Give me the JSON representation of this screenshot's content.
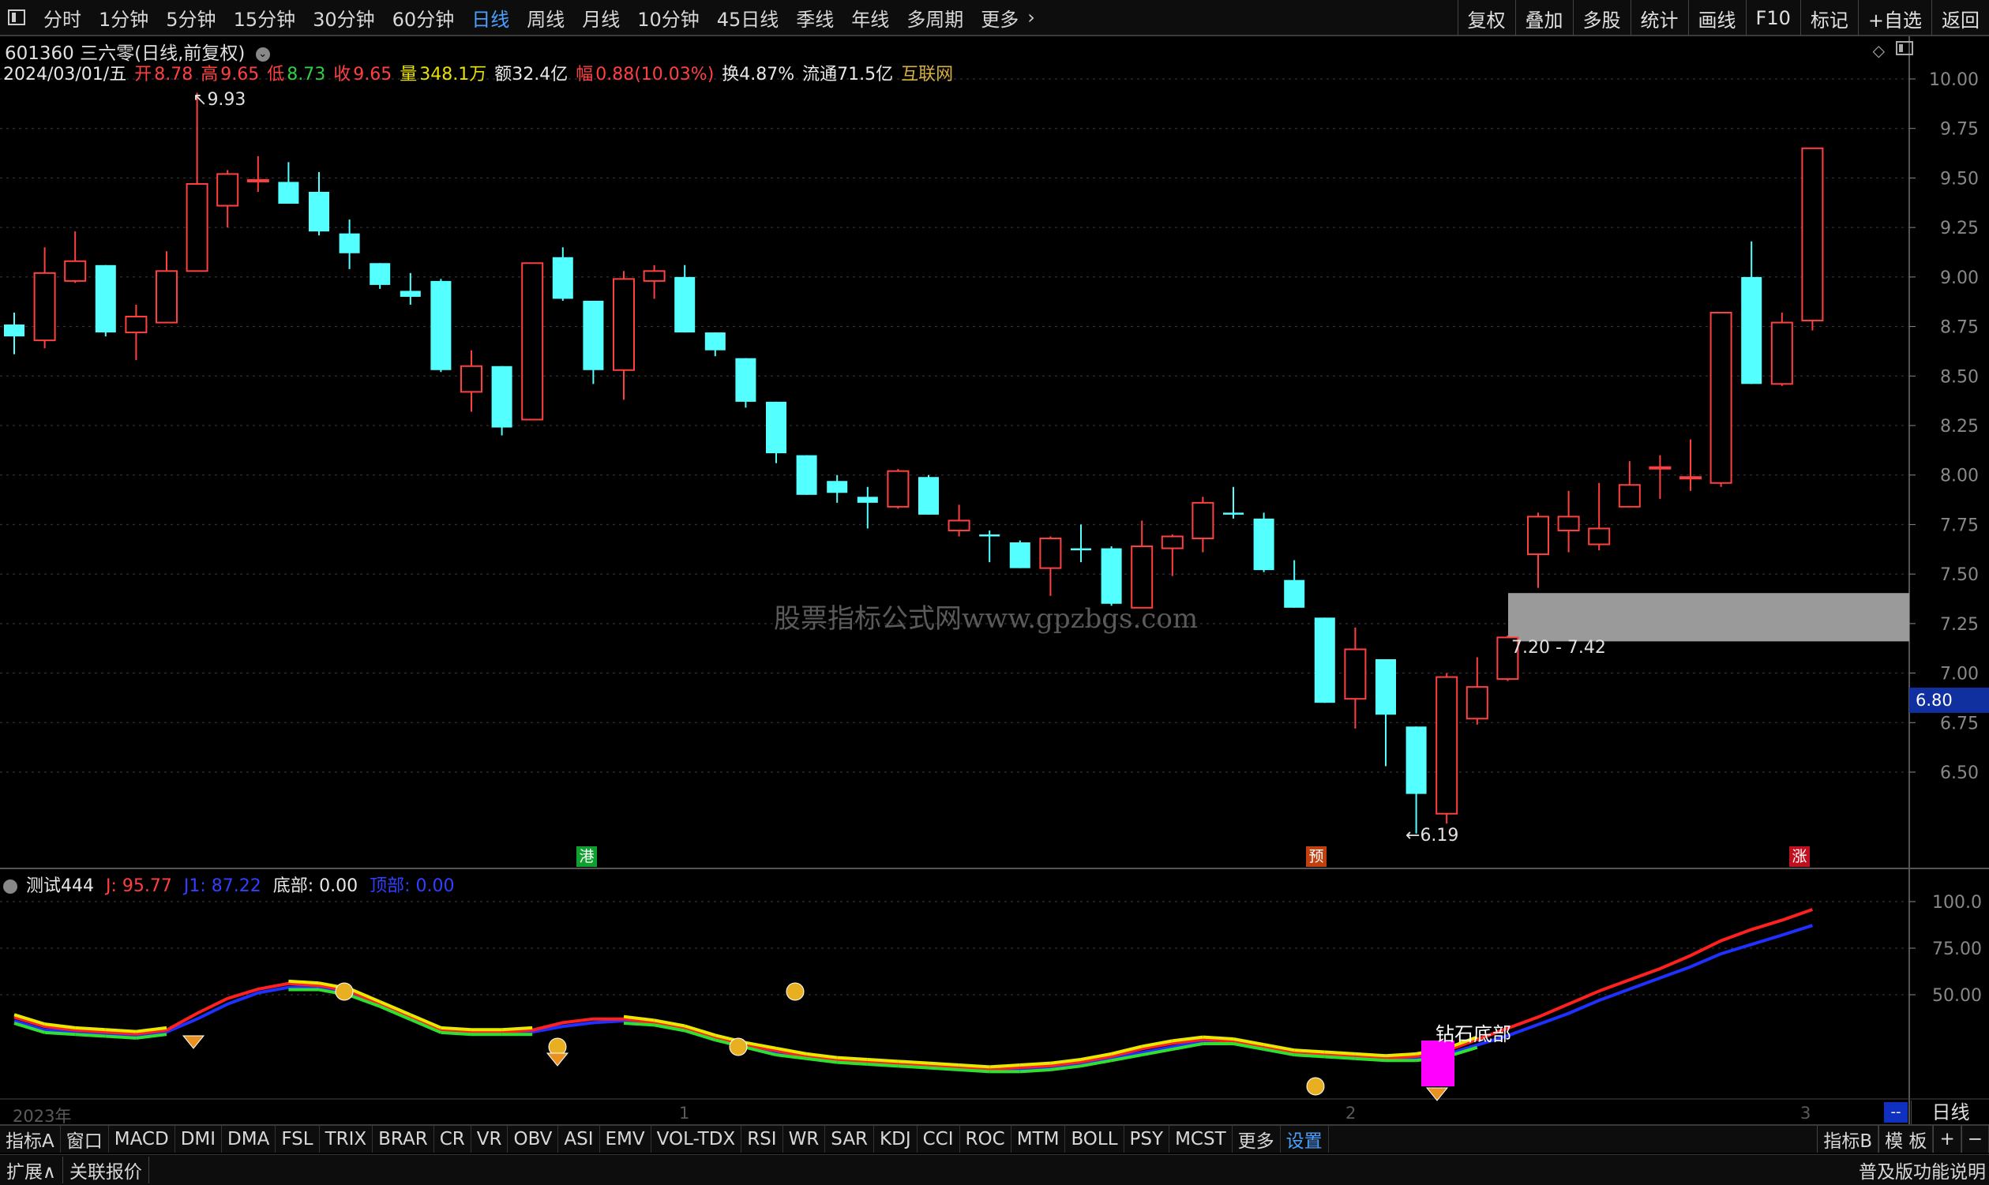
{
  "topbar": {
    "periods": [
      "分时",
      "1分钟",
      "5分钟",
      "15分钟",
      "30分钟",
      "60分钟",
      "日线",
      "周线",
      "月线",
      "10分钟",
      "45日线",
      "季线",
      "年线",
      "多周期",
      "更多"
    ],
    "active_period": "日线",
    "right_buttons": [
      "复权",
      "叠加",
      "多股",
      "统计",
      "画线",
      "F10",
      "标记",
      "+自选",
      "返回"
    ]
  },
  "stock": {
    "title": "601360 三六零(日线,前复权)",
    "date": "2024/03/01/五",
    "open_label": "开",
    "open": "8.78",
    "high_label": "高",
    "high": "9.65",
    "low_label": "低",
    "low": "8.73",
    "close_label": "收",
    "close": "9.65",
    "volume_label": "量",
    "volume": "348.1万",
    "amount": "额32.4亿",
    "change_label": "幅",
    "change": "0.88(10.03%)",
    "turnover": "换4.87%",
    "float_cap": "流通71.5亿",
    "concept": "互联网"
  },
  "chart_data": [
    {
      "type": "candlestick",
      "title": "601360 三六零(日线,前复权)",
      "ylim": [
        6.0,
        10.1
      ],
      "y_ticks": [
        "10.00",
        "9.75",
        "9.50",
        "9.25",
        "9.00",
        "8.75",
        "8.50",
        "8.25",
        "8.00",
        "7.75",
        "7.50",
        "7.25",
        "7.00",
        "6.75",
        "6.50"
      ],
      "x_labels": [
        "2023年",
        "1",
        "2",
        "3"
      ],
      "candles": [
        {
          "o": 8.76,
          "c": 8.7,
          "h": 8.82,
          "l": 8.61
        },
        {
          "o": 8.68,
          "c": 9.02,
          "h": 9.15,
          "l": 8.64
        },
        {
          "o": 8.98,
          "c": 9.08,
          "h": 9.23,
          "l": 8.97
        },
        {
          "o": 9.06,
          "c": 8.72,
          "h": 9.06,
          "l": 8.7
        },
        {
          "o": 8.72,
          "c": 8.8,
          "h": 8.86,
          "l": 8.58
        },
        {
          "o": 8.77,
          "c": 9.03,
          "h": 9.13,
          "l": 8.77
        },
        {
          "o": 9.03,
          "c": 9.47,
          "h": 9.93,
          "l": 9.03
        },
        {
          "o": 9.36,
          "c": 9.52,
          "h": 9.54,
          "l": 9.25
        },
        {
          "o": 9.49,
          "c": 9.49,
          "h": 9.61,
          "l": 9.43
        },
        {
          "o": 9.48,
          "c": 9.37,
          "h": 9.58,
          "l": 9.37
        },
        {
          "o": 9.43,
          "c": 9.23,
          "h": 9.53,
          "l": 9.21
        },
        {
          "o": 9.22,
          "c": 9.12,
          "h": 9.29,
          "l": 9.04
        },
        {
          "o": 9.07,
          "c": 8.96,
          "h": 9.07,
          "l": 8.94
        },
        {
          "o": 8.93,
          "c": 8.9,
          "h": 9.02,
          "l": 8.86
        },
        {
          "o": 8.98,
          "c": 8.53,
          "h": 8.99,
          "l": 8.52
        },
        {
          "o": 8.42,
          "c": 8.55,
          "h": 8.63,
          "l": 8.32
        },
        {
          "o": 8.55,
          "c": 8.24,
          "h": 8.55,
          "l": 8.2
        },
        {
          "o": 8.28,
          "c": 9.07,
          "h": 9.07,
          "l": 8.28
        },
        {
          "o": 9.1,
          "c": 8.89,
          "h": 9.15,
          "l": 8.88
        },
        {
          "o": 8.88,
          "c": 8.53,
          "h": 8.88,
          "l": 8.46
        },
        {
          "o": 8.53,
          "c": 8.99,
          "h": 9.03,
          "l": 8.38
        },
        {
          "o": 8.98,
          "c": 9.03,
          "h": 9.06,
          "l": 8.89
        },
        {
          "o": 9.0,
          "c": 8.72,
          "h": 9.06,
          "l": 8.72
        },
        {
          "o": 8.72,
          "c": 8.63,
          "h": 8.72,
          "l": 8.6
        },
        {
          "o": 8.59,
          "c": 8.37,
          "h": 8.59,
          "l": 8.34
        },
        {
          "o": 8.37,
          "c": 8.11,
          "h": 8.37,
          "l": 8.06
        },
        {
          "o": 8.1,
          "c": 7.9,
          "h": 8.1,
          "l": 7.9
        },
        {
          "o": 7.97,
          "c": 7.91,
          "h": 8.0,
          "l": 7.86
        },
        {
          "o": 7.89,
          "c": 7.86,
          "h": 7.94,
          "l": 7.73
        },
        {
          "o": 7.84,
          "c": 8.02,
          "h": 8.03,
          "l": 7.83
        },
        {
          "o": 7.99,
          "c": 7.8,
          "h": 8.0,
          "l": 7.8
        },
        {
          "o": 7.72,
          "c": 7.77,
          "h": 7.85,
          "l": 7.69
        },
        {
          "o": 7.7,
          "c": 7.69,
          "h": 7.72,
          "l": 7.56
        },
        {
          "o": 7.66,
          "c": 7.53,
          "h": 7.67,
          "l": 7.53
        },
        {
          "o": 7.53,
          "c": 7.68,
          "h": 7.69,
          "l": 7.39
        },
        {
          "o": 7.63,
          "c": 7.62,
          "h": 7.75,
          "l": 7.56
        },
        {
          "o": 7.63,
          "c": 7.35,
          "h": 7.64,
          "l": 7.34
        },
        {
          "o": 7.33,
          "c": 7.64,
          "h": 7.77,
          "l": 7.33
        },
        {
          "o": 7.63,
          "c": 7.69,
          "h": 7.7,
          "l": 7.49
        },
        {
          "o": 7.68,
          "c": 7.86,
          "h": 7.89,
          "l": 7.61
        },
        {
          "o": 7.81,
          "c": 7.8,
          "h": 7.94,
          "l": 7.78
        },
        {
          "o": 7.78,
          "c": 7.52,
          "h": 7.81,
          "l": 7.51
        },
        {
          "o": 7.47,
          "c": 7.33,
          "h": 7.57,
          "l": 7.33
        },
        {
          "o": 7.28,
          "c": 6.85,
          "h": 7.28,
          "l": 6.85
        },
        {
          "o": 6.87,
          "c": 7.12,
          "h": 7.23,
          "l": 6.72
        },
        {
          "o": 7.07,
          "c": 6.79,
          "h": 7.07,
          "l": 6.53
        },
        {
          "o": 6.73,
          "c": 6.39,
          "h": 6.73,
          "l": 6.19
        },
        {
          "o": 6.29,
          "c": 6.98,
          "h": 7.0,
          "l": 6.24
        },
        {
          "o": 6.77,
          "c": 6.93,
          "h": 7.08,
          "l": 6.74
        },
        {
          "o": 6.97,
          "c": 7.18,
          "h": 7.19,
          "l": 6.96
        },
        {
          "o": 7.6,
          "c": 7.79,
          "h": 7.81,
          "l": 7.43
        },
        {
          "o": 7.72,
          "c": 7.79,
          "h": 7.92,
          "l": 7.61
        },
        {
          "o": 7.65,
          "c": 7.73,
          "h": 7.96,
          "l": 7.62
        },
        {
          "o": 7.84,
          "c": 7.95,
          "h": 8.07,
          "l": 7.84
        },
        {
          "o": 8.04,
          "c": 8.04,
          "h": 8.1,
          "l": 7.88
        },
        {
          "o": 7.99,
          "c": 7.99,
          "h": 8.18,
          "l": 7.92
        },
        {
          "o": 7.96,
          "c": 8.82,
          "h": 8.82,
          "l": 7.94
        },
        {
          "o": 9.0,
          "c": 8.46,
          "h": 9.18,
          "l": 8.46
        },
        {
          "o": 8.46,
          "c": 8.77,
          "h": 8.82,
          "l": 8.45
        },
        {
          "o": 8.78,
          "c": 9.65,
          "h": 9.65,
          "l": 8.73
        }
      ],
      "support_band": {
        "low": 7.2,
        "high": 7.42,
        "label": "7.20 - 7.42",
        "color": "#9a9a9a"
      },
      "high_marker": "9.93",
      "low_marker": "6.19",
      "current_price_tag": "6.80",
      "colors": {
        "up": "#ff4040",
        "down": "#54ffff"
      }
    },
    {
      "type": "line",
      "title": "测试444",
      "ylim": [
        0,
        110
      ],
      "y_ticks": [
        "100.0",
        "75.00",
        "50.00"
      ],
      "series": [
        {
          "name": "J",
          "color": "#ff2020",
          "values": [
            38,
            33,
            31,
            30,
            29,
            31,
            40,
            48,
            53,
            56,
            55,
            52,
            45,
            38,
            31,
            30,
            30,
            31,
            35,
            37,
            37,
            35,
            32,
            27,
            23,
            20,
            17,
            15,
            14,
            13,
            12,
            11,
            10,
            11,
            12,
            14,
            17,
            21,
            24,
            26,
            25,
            22,
            19,
            18,
            17,
            16,
            17,
            20,
            26,
            32,
            38,
            45,
            52,
            58,
            64,
            71,
            79,
            85,
            90,
            95.77
          ]
        },
        {
          "name": "J1",
          "color": "#2030ff",
          "values": [
            36,
            31,
            30,
            29,
            28,
            30,
            37,
            45,
            51,
            54,
            54,
            51,
            45,
            38,
            31,
            30,
            30,
            30,
            33,
            35,
            36,
            35,
            32,
            27,
            23,
            19,
            17,
            15,
            14,
            13,
            12,
            11,
            10,
            10,
            11,
            13,
            16,
            19,
            22,
            25,
            25,
            22,
            19,
            18,
            17,
            16,
            16,
            18,
            23,
            28,
            34,
            40,
            47,
            53,
            59,
            65,
            72,
            77,
            82,
            87.22
          ]
        }
      ],
      "labels": {
        "bottom_label": "底部:",
        "bottom": "0.00",
        "top_label": "顶部:",
        "top": "0.00",
        "J": "J: 95.77",
        "J1": "J1: 87.22"
      },
      "signal_text": "钻石底部"
    }
  ],
  "indicator": {
    "name": "测试444",
    "j": "J: 95.77",
    "j1": "J1: 87.22",
    "bottom": "底部: 0.00",
    "top": "顶部: 0.00"
  },
  "watermark": "股票指标公式网www.gpzbgs.com",
  "markers": {
    "gang": "港",
    "yu": "预",
    "zhang": "涨"
  },
  "x_labels": [
    "2023年",
    "1",
    "2",
    "3"
  ],
  "day_button": "日线",
  "scroll_mark": "--",
  "indicator_tabs": [
    "指标A",
    "窗口",
    "MACD",
    "DMI",
    "DMA",
    "FSL",
    "TRIX",
    "BRAR",
    "CR",
    "VR",
    "OBV",
    "ASI",
    "EMV",
    "VOL-TDX",
    "RSI",
    "WR",
    "SAR",
    "KDJ",
    "CCI",
    "ROC",
    "MTM",
    "BOLL",
    "PSY",
    "MCST",
    "更多",
    "设置"
  ],
  "active_indicator_tab": "设置",
  "indicator_tabs_right": [
    "指标B",
    "模 板",
    "+",
    "−"
  ],
  "status": {
    "expand": "扩展∧",
    "related": "关联报价",
    "version_note": "普及版功能说明"
  }
}
